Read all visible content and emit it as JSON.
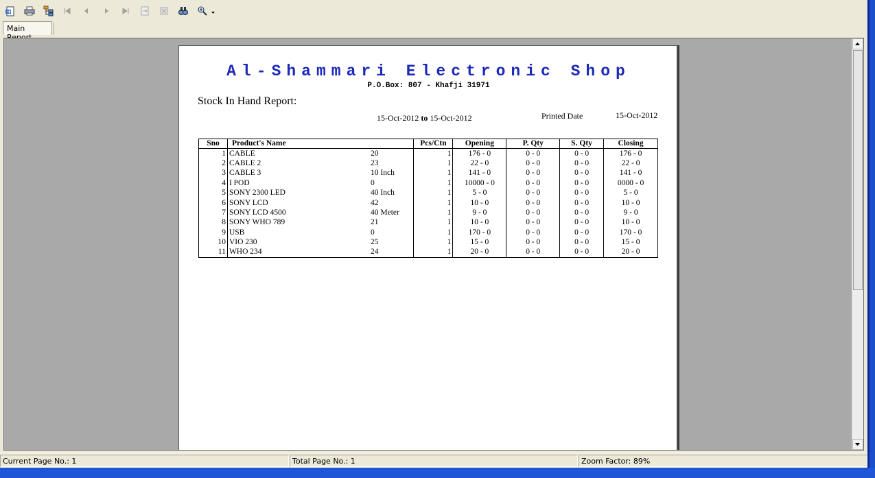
{
  "tabs": [
    {
      "label": "Main Report"
    }
  ],
  "report": {
    "shop_name": "Al-Shammari Electronic Shop",
    "address": "P.O.Box: 807 - Khafji 31971",
    "title": "Stock In Hand Report:",
    "date_from": "15-Oct-2012",
    "date_to_word": "to",
    "date_to": "15-Oct-2012",
    "printed_label": "Printed Date",
    "printed_date": "15-Oct-2012",
    "columns": [
      "Sno",
      "Product's  Name",
      "Pcs/Ctn",
      "Opening",
      "P. Qty",
      "S. Qty",
      "Closing"
    ],
    "rows": [
      {
        "sno": "1",
        "name": "CABLE",
        "unit": "20",
        "pcs": "1",
        "opening": "176  -  0",
        "pqty": "0  -  0",
        "sqty": "0 - 0",
        "closing": "176  -  0"
      },
      {
        "sno": "2",
        "name": "CABLE 2",
        "unit": "23",
        "pcs": "1",
        "opening": "22  -  0",
        "pqty": "0  -  0",
        "sqty": "0 - 0",
        "closing": "22  -  0"
      },
      {
        "sno": "3",
        "name": "CABLE 3",
        "unit": "10 Inch",
        "pcs": "1",
        "opening": "141  -  0",
        "pqty": "0  -  0",
        "sqty": "0 - 0",
        "closing": "141  -  0"
      },
      {
        "sno": "4",
        "name": "I POD",
        "unit": "0",
        "pcs": "1",
        "opening": "10000  -  0",
        "pqty": "0  -  0",
        "sqty": "0 - 0",
        "closing": "0000  -  0"
      },
      {
        "sno": "5",
        "name": "SONY 2300 LED",
        "unit": "40 Inch",
        "pcs": "1",
        "opening": "5  -  0",
        "pqty": "0  -  0",
        "sqty": "0 - 0",
        "closing": "5  -  0"
      },
      {
        "sno": "6",
        "name": "SONY LCD",
        "unit": "42",
        "pcs": "1",
        "opening": "10  -  0",
        "pqty": "0  -  0",
        "sqty": "0 - 0",
        "closing": "10  -  0"
      },
      {
        "sno": "7",
        "name": "SONY LCD 4500",
        "unit": "40 Meter",
        "pcs": "1",
        "opening": "9  -  0",
        "pqty": "0  -  0",
        "sqty": "0 - 0",
        "closing": "9  -  0"
      },
      {
        "sno": "8",
        "name": "SONY WHO 789",
        "unit": "21",
        "pcs": "1",
        "opening": "10  -  0",
        "pqty": "0  -  0",
        "sqty": "0 - 0",
        "closing": "10  -  0"
      },
      {
        "sno": "9",
        "name": "USB",
        "unit": "0",
        "pcs": "1",
        "opening": "170  -  0",
        "pqty": "0  -  0",
        "sqty": "0 - 0",
        "closing": "170  -  0"
      },
      {
        "sno": "10",
        "name": "VIO 230",
        "unit": "25",
        "pcs": "1",
        "opening": "15  -  0",
        "pqty": "0  -  0",
        "sqty": "0 - 0",
        "closing": "15  -  0"
      },
      {
        "sno": "11",
        "name": "WHO 234",
        "unit": "24",
        "pcs": "1",
        "opening": "20  -  0",
        "pqty": "0  -  0",
        "sqty": "0 - 0",
        "closing": "20  -  0"
      }
    ]
  },
  "status": {
    "current_page": "Current Page No.: 1",
    "total_page": "Total Page No.: 1",
    "zoom": "Zoom Factor: 89%"
  },
  "colors": {
    "title_blue": "#1c28b8",
    "viewer_bg": "#a9a9a9",
    "taskbar_blue": "#1f56d6"
  }
}
